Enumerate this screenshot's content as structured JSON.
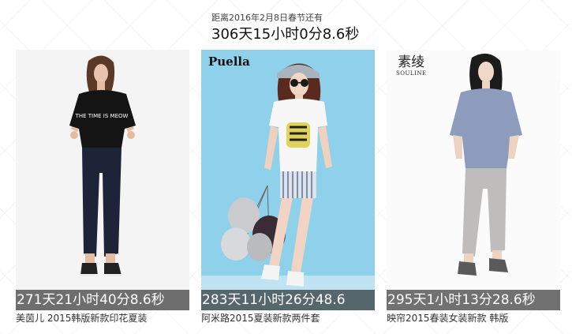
{
  "countdown": {
    "caption": "距离2016年2月8日春节还有",
    "remaining": "306天15小时0分8.6秒"
  },
  "products": [
    {
      "timer": "271天21小时40分8.6秒",
      "title": "美茵儿 2015韩版新款印花夏装",
      "shirt_text": "THE TIME IS MEOW"
    },
    {
      "brand": "Puella",
      "timer": "283天11小时26分48.6",
      "title": "阿米路2015夏装新款两件套"
    },
    {
      "brand_cn": "素绫",
      "brand_en": "SOULINE",
      "timer": "295天1小时13分28.6秒",
      "title": "映帘2015春装女装新款 韩版"
    }
  ],
  "colors": {
    "timer_overlay": "#000000",
    "background": "#ffffff",
    "sky_blue": "#8fd0ea"
  }
}
